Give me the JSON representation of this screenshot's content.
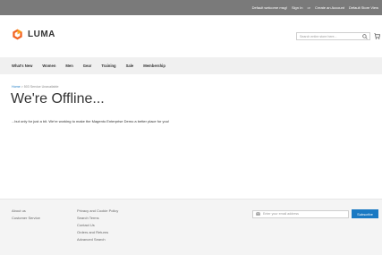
{
  "top_bar": {
    "welcome": "Default welcome msg!",
    "sign_in": "Sign In",
    "or": "or",
    "create_account": "Create an Account",
    "store_view": "Default Store View"
  },
  "header": {
    "logo_text": "LUMA",
    "search_placeholder": "Search entire store here...",
    "brand_color": "#f26322"
  },
  "nav": {
    "items": [
      "What's New",
      "Women",
      "Men",
      "Gear",
      "Training",
      "Sale",
      "Membership"
    ]
  },
  "breadcrumb": {
    "home": "Home",
    "current": "503 Service Unavailable"
  },
  "main": {
    "title": "We're Offline...",
    "message": "...but only for just a bit. We're working to make the Magento Enterprise Demo a better place for you!"
  },
  "footer": {
    "col1": [
      "About us",
      "Customer Service"
    ],
    "col2": [
      "Privacy and Cookie Policy",
      "Search Terms",
      "Contact Us",
      "Orders and Returns",
      "Advanced Search"
    ],
    "newsletter_placeholder": "Enter your email address",
    "subscribe_label": "Subscribe",
    "accent_color": "#1979c3"
  }
}
